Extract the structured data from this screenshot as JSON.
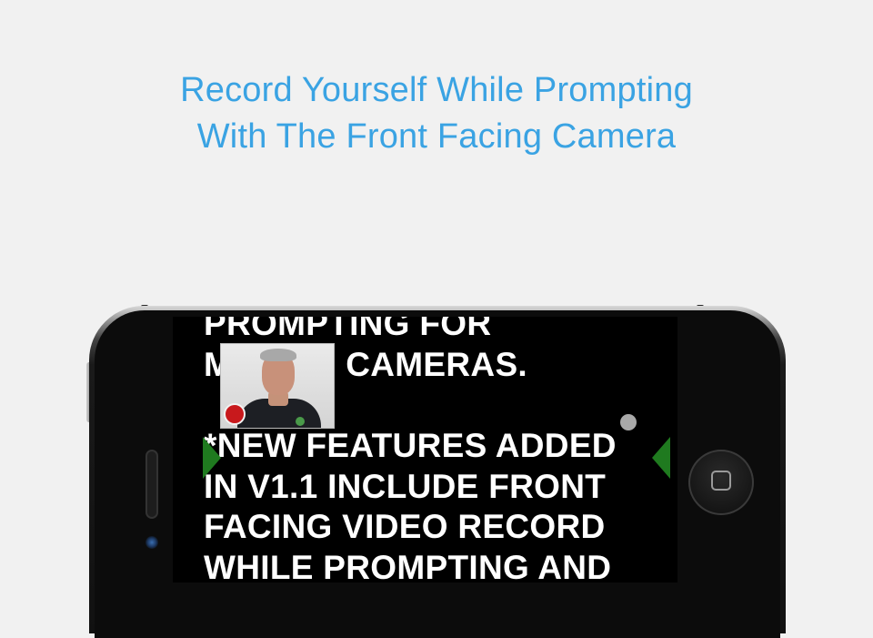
{
  "headline": {
    "line1": "Record Yourself While Prompting",
    "line2": "With The Front Facing Camera"
  },
  "prompter": {
    "lines": [
      "PROMPTING FOR",
      "MOBILE CAMERAS.",
      "",
      "*NEW FEATURES ADDED",
      "IN V1.1 INCLUDE FRONT",
      "FACING VIDEO RECORD",
      "WHILE PROMPTING AND"
    ]
  },
  "colors": {
    "headline": "#3aa3e3",
    "background": "#f1f1f1",
    "screen": "#000000",
    "prompter_text": "#ffffff",
    "marker": "#1f7a1f",
    "record": "#c8191c"
  },
  "icons": {
    "record": "record-circle-icon",
    "markers": "triangle-marker-icon",
    "home": "home-button-icon"
  }
}
